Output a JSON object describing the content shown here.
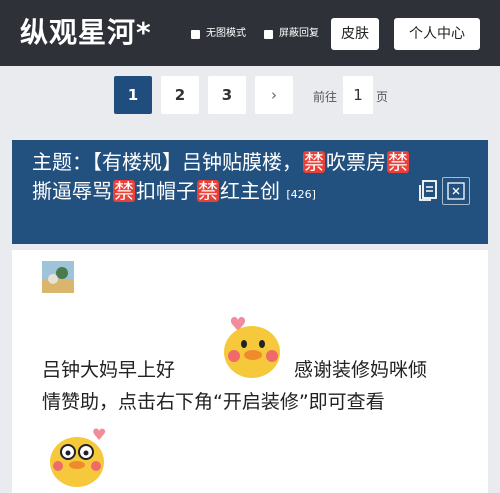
{
  "header": {
    "brand": "纵观星河*",
    "options": [
      "无图模式",
      "屏蔽回复"
    ],
    "skin_button": "皮肤",
    "user_center_button": "个人中心"
  },
  "pagination": {
    "pages": [
      "1",
      "2",
      "3"
    ],
    "current": "1",
    "next": "›",
    "goto_label": "前往",
    "goto_value": "1",
    "page_unit": "页"
  },
  "topic": {
    "part1": "主题：【有楼规】吕钟贴膜楼，",
    "ban": "禁",
    "part2": "吹票房",
    "part3": "撕逼辱骂",
    "part4": "扣帽子",
    "part5": "红主创",
    "count": "[426]"
  },
  "post": {
    "line1_start": "吕钟大妈早上好",
    "line1_end": "感谢装修妈咪倾",
    "line2": "情赞助，点击右下角“开启装修”即可查看"
  },
  "colors": {
    "header_bg": "#2e3138",
    "accent_blue": "#1f4e7e",
    "topic_bg": "#23517f",
    "ban_red": "#e8413a"
  }
}
